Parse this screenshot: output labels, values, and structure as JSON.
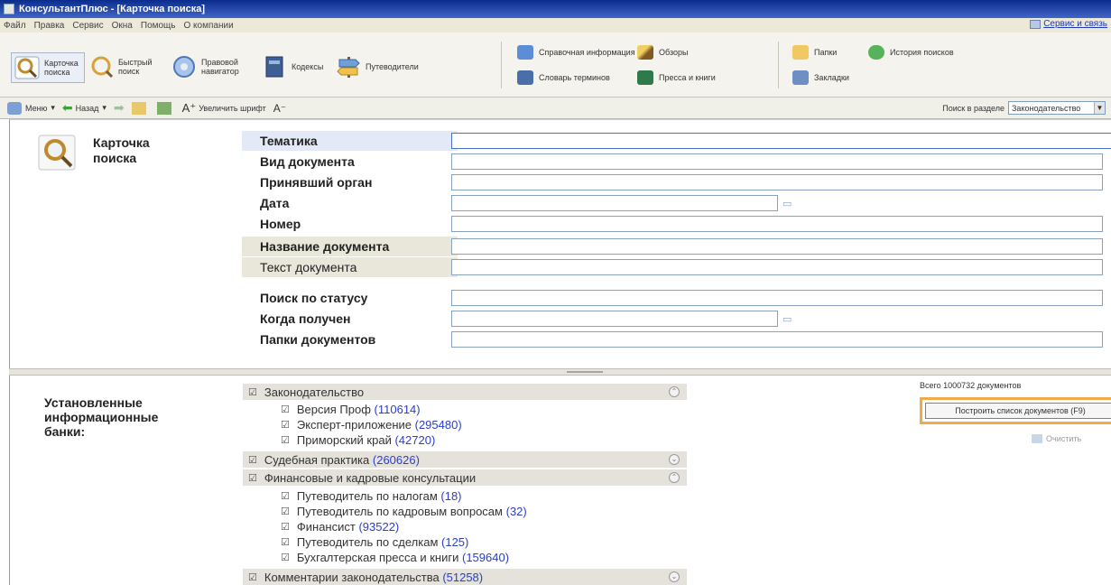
{
  "window": {
    "title": "КонсультантПлюс - [Карточка поиска]"
  },
  "menubar": {
    "items": [
      "Файл",
      "Правка",
      "Сервис",
      "Окна",
      "Помощь",
      "О компании"
    ],
    "right_link": "Сервис и связь"
  },
  "toolbar": {
    "search_card": "Карточка поиска",
    "quick_search": "Быстрый поиск",
    "legal_navigator": "Правовой навигатор",
    "codes": "Кодексы",
    "guide": "Путеводители",
    "reference_info": "Справочная информация",
    "reviews": "Обзоры",
    "folders": "Папки",
    "history": "История поисков",
    "terms_dictionary": "Словарь терминов",
    "press_books": "Пресса и книги",
    "bookmarks": "Закладки"
  },
  "navbar": {
    "menu": "Меню",
    "back": "Назад",
    "increase_font": "Увеличить шрифт",
    "section_label": "Поиск в разделе",
    "section_value": "Законодательство"
  },
  "card": {
    "title_line1": "Карточка",
    "title_line2": "поиска",
    "fields": [
      {
        "label": "Тематика",
        "value": ""
      },
      {
        "label": "Вид документа",
        "value": ""
      },
      {
        "label": "Принявший орган",
        "value": ""
      },
      {
        "label": "Дата",
        "value": ""
      },
      {
        "label": "Номер",
        "value": ""
      },
      {
        "label": "Название документа",
        "value": ""
      },
      {
        "label": "Текст документа",
        "value": ""
      },
      {
        "label": "Поиск по статусу",
        "value": ""
      },
      {
        "label": "Когда получен",
        "value": ""
      },
      {
        "label": "Папки документов",
        "value": ""
      }
    ]
  },
  "banks": {
    "title_line1": "Установленные",
    "title_line2": "информационные",
    "title_line3": "банки:",
    "groups": [
      {
        "name": "Законодательство",
        "count": "",
        "items": [
          {
            "name": "Версия Проф",
            "count": "(110614)"
          },
          {
            "name": "Эксперт-приложение",
            "count": "(295480)"
          },
          {
            "name": "Приморский край",
            "count": "(42720)"
          }
        ]
      },
      {
        "name": "Судебная практика",
        "count": "(260626)",
        "items": []
      },
      {
        "name": "Финансовые и кадровые консультации",
        "count": "",
        "items": [
          {
            "name": "Путеводитель по налогам",
            "count": "(18)"
          },
          {
            "name": "Путеводитель по кадровым вопросам",
            "count": "(32)"
          },
          {
            "name": "Финансист",
            "count": "(93522)"
          },
          {
            "name": "Путеводитель по сделкам",
            "count": "(125)"
          },
          {
            "name": "Бухгалтерская пресса и книги",
            "count": "(159640)"
          }
        ]
      },
      {
        "name": "Комментарии законодательства",
        "count": "(51258)",
        "items": []
      }
    ],
    "total": "Всего 1000732 документов",
    "search_all": "Построить список документов (F9)",
    "build_list": "Очистить"
  }
}
